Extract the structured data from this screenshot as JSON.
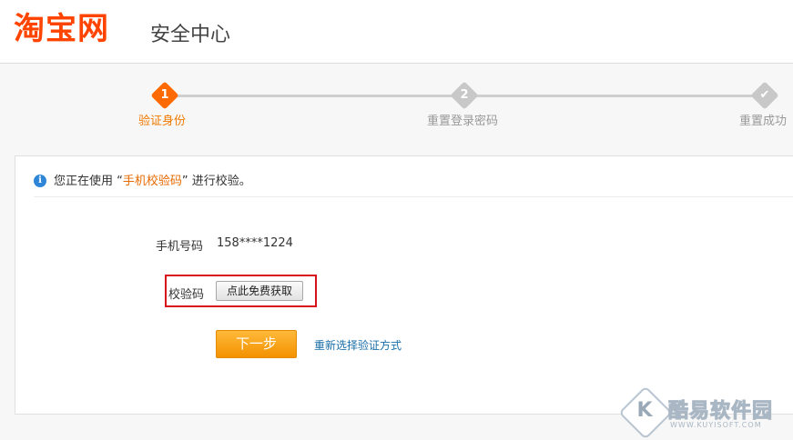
{
  "header": {
    "logo_text": "淘宝网",
    "section_title": "安全中心"
  },
  "stepper": {
    "steps": [
      {
        "number": "1",
        "label": "验证身份",
        "state": "active"
      },
      {
        "number": "2",
        "label": "重置登录密码",
        "state": "inactive"
      },
      {
        "number": "✔",
        "label": "重置成功",
        "state": "inactive"
      }
    ],
    "colors": {
      "active": "#ff6a00",
      "inactive": "#c8c8c8"
    }
  },
  "notice": {
    "icon": "info-icon",
    "prefix": "您正在使用 “",
    "method": "手机校验码",
    "suffix": "” 进行校验。"
  },
  "form": {
    "phone_label": "手机号码",
    "phone_value": "158****1224",
    "code_label": "校验码",
    "get_code_button": "点此免费获取",
    "next_button": "下一步",
    "reselect_link": "重新选择验证方式"
  },
  "watermark": {
    "icon_letter": "K",
    "text": "酷易软件园",
    "url": "WWW.KUYISOFT.COM"
  }
}
